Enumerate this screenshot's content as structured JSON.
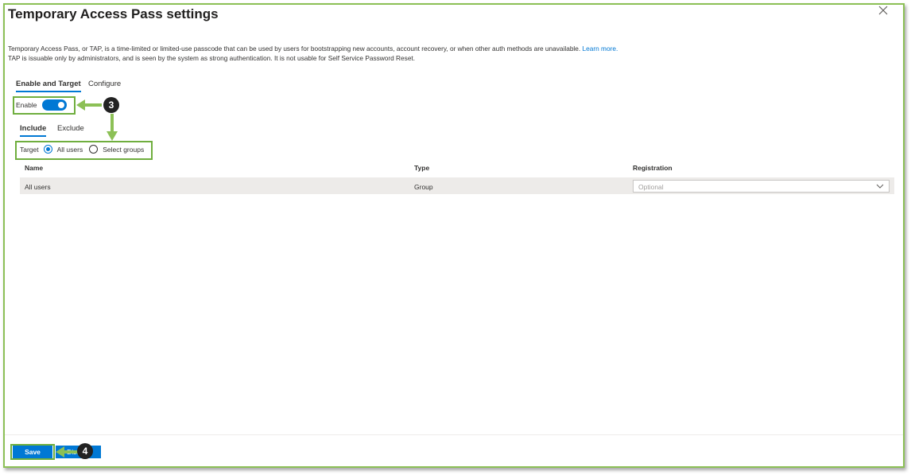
{
  "panel": {
    "title": "Temporary Access Pass settings",
    "more_label": "···",
    "description_line1": "Temporary Access Pass, or TAP, is a time-limited or limited-use passcode that can be used by users for bootstrapping new accounts, account recovery, or when other auth methods are unavailable.",
    "learn_more": "Learn more.",
    "description_line2": "TAP is issuable only by administrators, and is seen by the system as strong authentication. It is not usable for Self Service Password Reset."
  },
  "tabs": [
    {
      "label": "Enable and Target",
      "active": true
    },
    {
      "label": "Configure",
      "active": false
    }
  ],
  "enable": {
    "label": "Enable",
    "on": true
  },
  "subtabs": [
    {
      "label": "Include",
      "active": true
    },
    {
      "label": "Exclude",
      "active": false
    }
  ],
  "target": {
    "label": "Target",
    "options": [
      {
        "label": "All users",
        "checked": true
      },
      {
        "label": "Select groups",
        "checked": false
      }
    ]
  },
  "table": {
    "columns": [
      "Name",
      "Type",
      "Registration"
    ],
    "rows": [
      {
        "name": "All users",
        "type": "Group",
        "registration_placeholder": "Optional"
      }
    ]
  },
  "footer": {
    "save_label": "Save",
    "discard_label": "Discard"
  },
  "annotations": {
    "step3": "3",
    "step4": "4"
  },
  "colors": {
    "accent": "#0078d4",
    "highlight": "#6fae3e",
    "row_bg": "#edebe9"
  }
}
